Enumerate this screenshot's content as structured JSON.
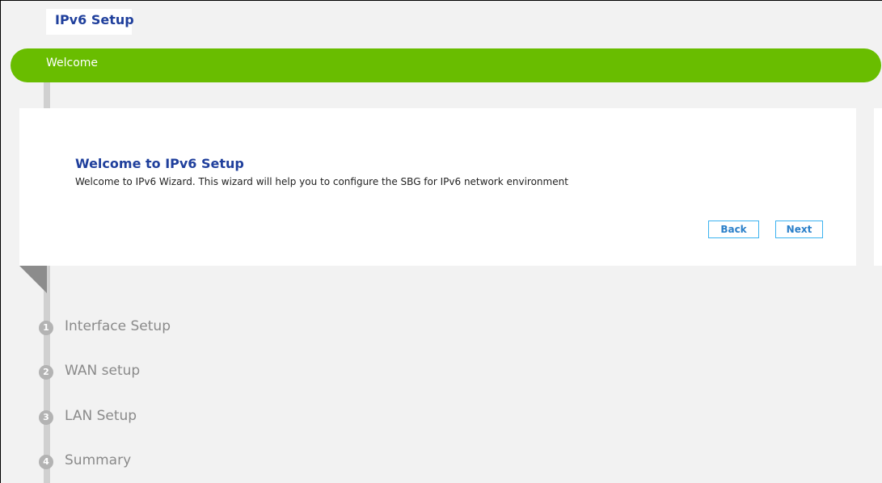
{
  "header": {
    "title": "IPv6 Setup"
  },
  "progress": {
    "current_step_label": "Welcome"
  },
  "panel": {
    "heading": "Welcome to IPv6 Setup",
    "description": "Welcome to IPv6 Wizard. This wizard will help you to configure the SBG for IPv6 network environment",
    "back_label": "Back",
    "next_label": "Next"
  },
  "steps": [
    {
      "number": "1",
      "label": "Interface Setup"
    },
    {
      "number": "2",
      "label": "WAN setup"
    },
    {
      "number": "3",
      "label": "LAN Setup"
    },
    {
      "number": "4",
      "label": "Summary"
    }
  ],
  "colors": {
    "accent_green": "#69bd00",
    "title_blue": "#1f3f9c",
    "button_border": "#3cb3f0"
  }
}
